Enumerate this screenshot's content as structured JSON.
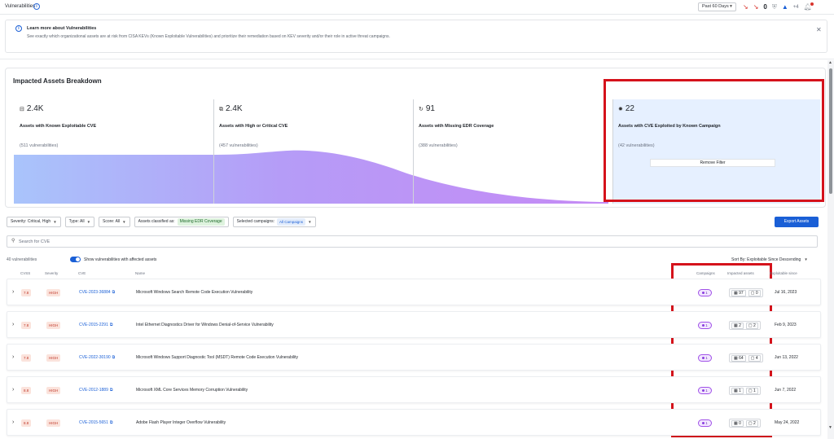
{
  "header": {
    "title": "Vulnerabilities",
    "period": "Past 60 Days",
    "status_counter": "0",
    "user_extra": "+4",
    "icons": [
      "trend-icon",
      "trend-icon",
      "shield-icon",
      "azure-icon",
      "bell-icon"
    ]
  },
  "banner": {
    "title": "Learn more about Vulnerabilities",
    "text": "See exactly which organizational assets are at risk from CISA KEVs (Known Exploitable Vulnerabilities) and prioritize their remediation based on KEV severity and/or their role in active threat campaigns."
  },
  "breakdown": {
    "title": "Impacted Assets Breakdown",
    "stages": [
      {
        "icon": "asset-icon",
        "count": "2.4K",
        "label": "Assets with Known Exploitable CVE",
        "sub": "(511 vulnerabilities)"
      },
      {
        "icon": "layers-icon",
        "count": "2.4K",
        "label": "Assets with High or Critical CVE",
        "sub": "(457 vulnerabilities)"
      },
      {
        "icon": "edr-icon",
        "count": "91",
        "label": "Assets with Missing EDR Coverage",
        "sub": "(388 vulnerabilities)"
      },
      {
        "icon": "bug-icon",
        "count": "22",
        "label": "Assets with CVE Exploited by Known Campaign",
        "sub": "(42 vulnerabilities)"
      }
    ],
    "remove_filter": "Remove Filter"
  },
  "filters": {
    "severity": "Severity: Critical, High",
    "type": "Type: All",
    "score": "Score: All",
    "classified_label": "Assets classified as:",
    "classified_value": "Missing EDR Coverage",
    "campaigns_label": "Selected campaigns:",
    "campaigns_value": "All Campaigns",
    "export": "Export Assets"
  },
  "search": {
    "placeholder": "Search for CVE"
  },
  "table": {
    "count": "40 vulnerabilities",
    "toggle_label": "Show vulnerabilities with affected assets",
    "sort": "Sort By: Exploitable Since Descending",
    "headers": {
      "cvss": "CVSS",
      "severity": "Severity",
      "cve": "CVE",
      "name": "Name",
      "campaigns": "Campaigns",
      "impacted": "Impacted assets",
      "exploitable": "Exploitable since"
    },
    "rows": [
      {
        "cvss": "7.8",
        "severity": "HIGH",
        "cve": "CVE-2023-36884",
        "name": "Microsoft Windows Search Remote Code Execution Vulnerability",
        "campaigns": "1",
        "assets_a": "97",
        "assets_b": "0",
        "date": "Jul 16, 2023"
      },
      {
        "cvss": "7.8",
        "severity": "HIGH",
        "cve": "CVE-2015-2291",
        "name": "Intel Ethernet Diagnostics Driver for Windows Denial-of-Service Vulnerability",
        "campaigns": "1",
        "assets_a": "2",
        "assets_b": "2",
        "date": "Feb 9, 2023"
      },
      {
        "cvss": "7.8",
        "severity": "HIGH",
        "cve": "CVE-2022-30190",
        "name": "Microsoft Windows Support Diagnostic Tool (MSDT) Remote Code Execution Vulnerability",
        "campaigns": "1",
        "assets_a": "64",
        "assets_b": "4",
        "date": "Jun 13, 2022"
      },
      {
        "cvss": "8.8",
        "severity": "HIGH",
        "cve": "CVE-2012-1889",
        "name": "Microsoft XML Core Services Memory Corruption Vulnerability",
        "campaigns": "1",
        "assets_a": "1",
        "assets_b": "1",
        "date": "Jun 7, 2022"
      },
      {
        "cvss": "8.8",
        "severity": "HIGH",
        "cve": "CVE-2015-5651",
        "name": "Adobe Flash Player Integer Overflow Vulnerability",
        "campaigns": "1",
        "assets_a": "0",
        "assets_b": "2",
        "date": "May 24, 2022"
      }
    ]
  },
  "colors": {
    "accent": "#1a5fd6",
    "highlight_box": "#d5121b",
    "severity_bg": "#fbe3dc",
    "campaign": "#a050e8",
    "flow_start": "#a9c4fb",
    "flow_end": "#c58af5"
  }
}
